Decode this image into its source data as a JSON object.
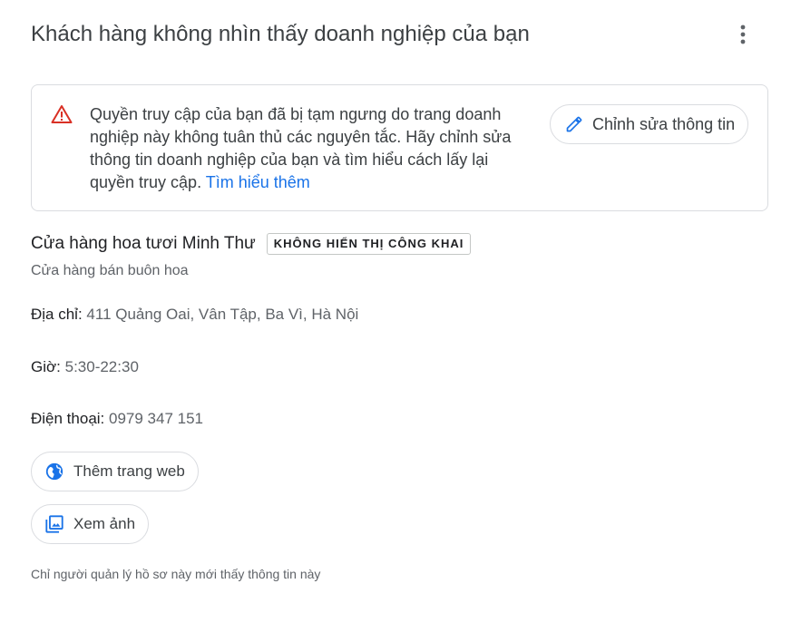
{
  "header": {
    "title": "Khách hàng không nhìn thấy doanh nghiệp của bạn",
    "more_icon": "more-vert-icon"
  },
  "alert": {
    "icon": "warning-icon",
    "text": "Quyền truy cập của bạn đã bị tạm ngưng do trang doanh nghiệp này không tuân thủ các nguyên tắc. Hãy chỉnh sửa thông tin doanh nghiệp của bạn và tìm hiểu cách lấy lại quyền truy cập.",
    "link_label": "Tìm hiểu thêm",
    "edit_button_label": "Chỉnh sửa thông tin",
    "edit_icon": "pencil-icon"
  },
  "business": {
    "name": "Cửa hàng hoa tươi Minh Thư",
    "status_badge": "KHÔNG HIỂN THỊ CÔNG KHAI",
    "category": "Cửa hàng bán buôn hoa"
  },
  "details": {
    "address_label": "Địa chỉ:",
    "address_value": "411 Quảng Oai, Vân Tập, Ba Vì, Hà Nội",
    "hours_label": "Giờ:",
    "hours_value": "5:30-22:30",
    "phone_label": "Điện thoại:",
    "phone_value": "0979 347 151"
  },
  "actions": {
    "add_website_label": "Thêm trang web",
    "add_website_icon": "globe-icon",
    "view_photos_label": "Xem ảnh",
    "view_photos_icon": "photo-library-icon"
  },
  "footer": {
    "note": "Chỉ người quản lý hồ sơ này mới thấy thông tin này"
  },
  "colors": {
    "accent": "#1a73e8",
    "warning": "#d93025",
    "border": "#dadce0"
  }
}
